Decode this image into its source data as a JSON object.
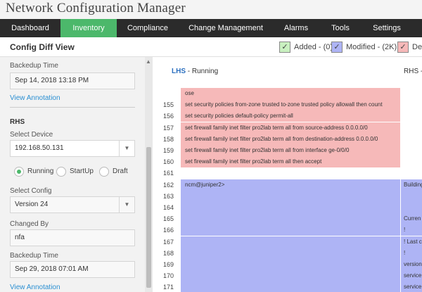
{
  "app": {
    "title": "Network Configuration Manager"
  },
  "nav": {
    "items": [
      {
        "label": "Dashboard",
        "active": false
      },
      {
        "label": "Inventory",
        "active": true
      },
      {
        "label": "Compliance",
        "active": false
      },
      {
        "label": "Change Management",
        "active": false
      },
      {
        "label": "Alarms",
        "active": false
      },
      {
        "label": "Tools",
        "active": false
      },
      {
        "label": "Settings",
        "active": false
      }
    ]
  },
  "toolbar": {
    "title": "Config Diff View",
    "legend": [
      {
        "label": "Added - (0)",
        "color": "#c9f0c0",
        "symbol": "✓"
      },
      {
        "label": "Modified - (2K)",
        "color": "#aeb4f5",
        "symbol": "✓"
      },
      {
        "label": "Del",
        "color": "#f6b9b9",
        "symbol": "✓"
      }
    ]
  },
  "sidebar": {
    "lhs": {
      "backup_time_label": "Backedup Time",
      "backup_time_value": "Sep 14, 2018 13:18 PM",
      "view_annotation": "View Annotation"
    },
    "rhs": {
      "heading": "RHS",
      "select_device_label": "Select Device",
      "device_value": "192.168.50.131",
      "radios": [
        {
          "label": "Running",
          "selected": true
        },
        {
          "label": "StartUp",
          "selected": false
        },
        {
          "label": "Draft",
          "selected": false
        }
      ],
      "select_config_label": "Select Config",
      "config_value": "Version 24",
      "changed_by_label": "Changed By",
      "changed_by_value": "nfa",
      "backup_time_label": "Backedup Time",
      "backup_time_value": "Sep 29, 2018 07:01 AM",
      "view_annotation": "View Annotation"
    }
  },
  "diff": {
    "lhs_tag": "LHS",
    "lhs_title": " - Running",
    "rhs_heading": "RHS - I",
    "rows": [
      {
        "no": "",
        "lhs": "ose",
        "rhs": "",
        "type": "del"
      },
      {
        "no": "155",
        "lhs": "set security policies from-zone trusted to-zone trusted policy allowall then count",
        "rhs": "",
        "type": "del"
      },
      {
        "no": "156",
        "lhs": "set security policies default-policy permit-all",
        "rhs": "",
        "type": "del"
      },
      {
        "no": "157",
        "lhs": "set firewall family inet filter pro2lab term all from source-address 0.0.0.0/0",
        "rhs": "",
        "type": "del"
      },
      {
        "no": "158",
        "lhs": "set firewall family inet filter pro2lab term all from destination-address 0.0.0.0/0",
        "rhs": "",
        "type": "del"
      },
      {
        "no": "159",
        "lhs": "set firewall family inet filter pro2lab term all from interface ge-0/0/0",
        "rhs": "",
        "type": "del"
      },
      {
        "no": "160",
        "lhs": "set firewall family inet filter pro2lab term all then accept",
        "rhs": "",
        "type": "del"
      },
      {
        "no": "161",
        "lhs": "",
        "rhs": "",
        "type": "white"
      },
      {
        "no": "162",
        "lhs": "ncm@juniper2>",
        "rhs": "Building",
        "type": "mod"
      },
      {
        "no": "163",
        "lhs": "",
        "rhs": "",
        "type": "mod"
      },
      {
        "no": "164",
        "lhs": "",
        "rhs": "",
        "type": "mod"
      },
      {
        "no": "165",
        "lhs": "",
        "rhs": "Curren",
        "type": "mod"
      },
      {
        "no": "166",
        "lhs": "",
        "rhs": "!",
        "type": "mod"
      },
      {
        "no": "167",
        "lhs": "",
        "rhs": "! Last c",
        "type": "mod"
      },
      {
        "no": "168",
        "lhs": "",
        "rhs": "!",
        "type": "mod"
      },
      {
        "no": "169",
        "lhs": "",
        "rhs": "version",
        "type": "mod"
      },
      {
        "no": "170",
        "lhs": "",
        "rhs": "service",
        "type": "mod"
      },
      {
        "no": "171",
        "lhs": "",
        "rhs": "service",
        "type": "mod"
      }
    ]
  }
}
